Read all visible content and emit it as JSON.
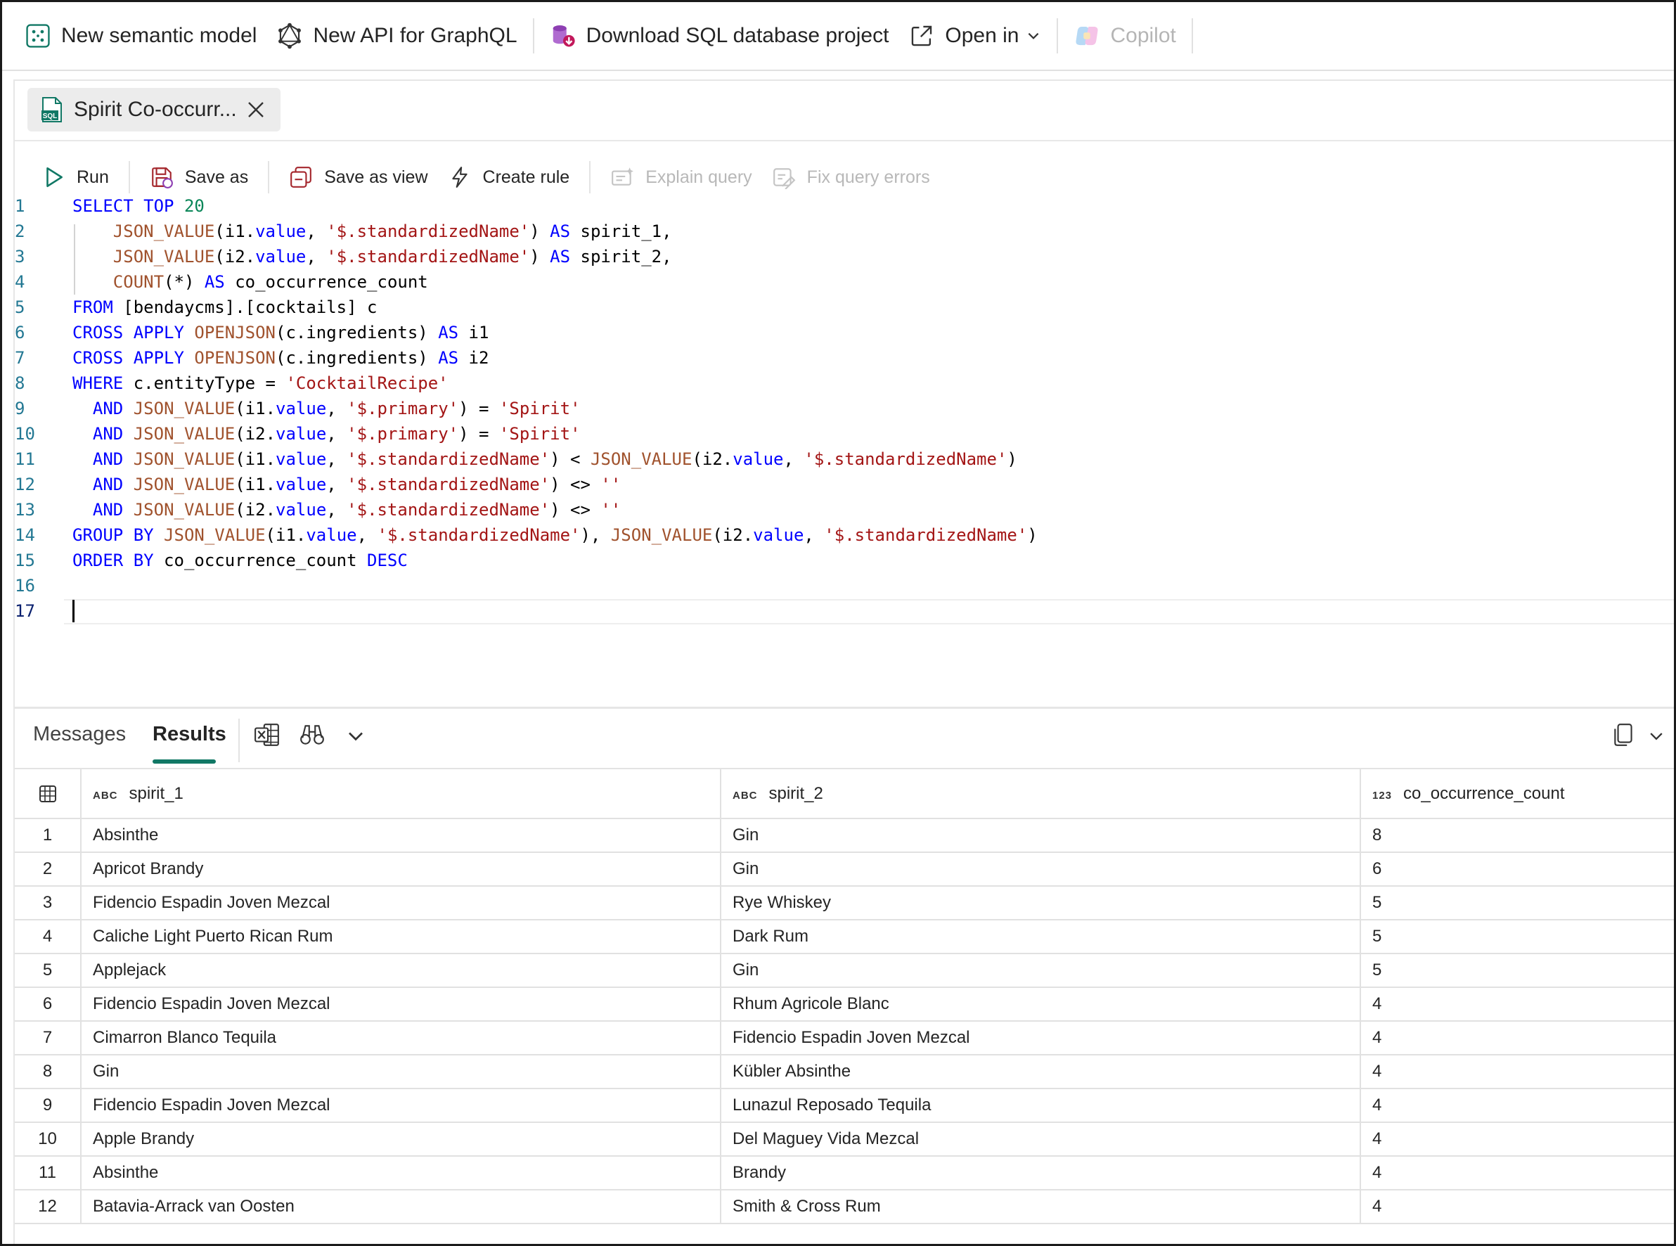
{
  "ribbon": {
    "items": [
      {
        "label": "New semantic model",
        "icon": "semantic-model-icon"
      },
      {
        "label": "New API for GraphQL",
        "icon": "graphql-icon"
      },
      {
        "label": "Download SQL database project",
        "icon": "sql-project-icon"
      },
      {
        "label": "Open in",
        "icon": "open-external-icon"
      },
      {
        "label": "Copilot",
        "icon": "copilot-icon"
      }
    ]
  },
  "editor": {
    "tab_label": "Spirit Co-occurr...",
    "toolbar": {
      "run": "Run",
      "save_as": "Save as",
      "save_as_view": "Save as view",
      "create_rule": "Create rule",
      "explain_query": "Explain query",
      "fix_query_errors": "Fix query errors"
    },
    "line_numbers": [
      "1",
      "2",
      "3",
      "4",
      "5",
      "6",
      "7",
      "8",
      "9",
      "10",
      "11",
      "12",
      "13",
      "14",
      "15",
      "16",
      "17"
    ]
  },
  "results": {
    "tabs": {
      "messages": "Messages",
      "results": "Results"
    },
    "columns": [
      {
        "type": "ABC",
        "name": "spirit_1"
      },
      {
        "type": "ABC",
        "name": "spirit_2"
      },
      {
        "type": "123",
        "name": "co_occurrence_count"
      }
    ],
    "rows": [
      {
        "n": "1",
        "spirit_1": "Absinthe",
        "spirit_2": "Gin",
        "count": "8"
      },
      {
        "n": "2",
        "spirit_1": "Apricot Brandy",
        "spirit_2": "Gin",
        "count": "6"
      },
      {
        "n": "3",
        "spirit_1": "Fidencio Espadin Joven Mezcal",
        "spirit_2": "Rye Whiskey",
        "count": "5"
      },
      {
        "n": "4",
        "spirit_1": "Caliche Light Puerto Rican Rum",
        "spirit_2": "Dark Rum",
        "count": "5"
      },
      {
        "n": "5",
        "spirit_1": "Applejack",
        "spirit_2": "Gin",
        "count": "5"
      },
      {
        "n": "6",
        "spirit_1": "Fidencio Espadin Joven Mezcal",
        "spirit_2": "Rhum Agricole Blanc",
        "count": "4"
      },
      {
        "n": "7",
        "spirit_1": "Cimarron Blanco Tequila",
        "spirit_2": "Fidencio Espadin Joven Mezcal",
        "count": "4"
      },
      {
        "n": "8",
        "spirit_1": "Gin",
        "spirit_2": "Kübler Absinthe",
        "count": "4"
      },
      {
        "n": "9",
        "spirit_1": "Fidencio Espadin Joven Mezcal",
        "spirit_2": "Lunazul Reposado Tequila",
        "count": "4"
      },
      {
        "n": "10",
        "spirit_1": "Apple Brandy",
        "spirit_2": "Del Maguey Vida Mezcal",
        "count": "4"
      },
      {
        "n": "11",
        "spirit_1": "Absinthe",
        "spirit_2": "Brandy",
        "count": "4"
      },
      {
        "n": "12",
        "spirit_1": "Batavia-Arrack van Oosten",
        "spirit_2": "Smith & Cross Rum",
        "count": "4"
      }
    ]
  },
  "colors": {
    "accent": "#117865",
    "keyword": "#0000ff",
    "string": "#a31515",
    "function": "#795e26",
    "number": "#098658"
  }
}
